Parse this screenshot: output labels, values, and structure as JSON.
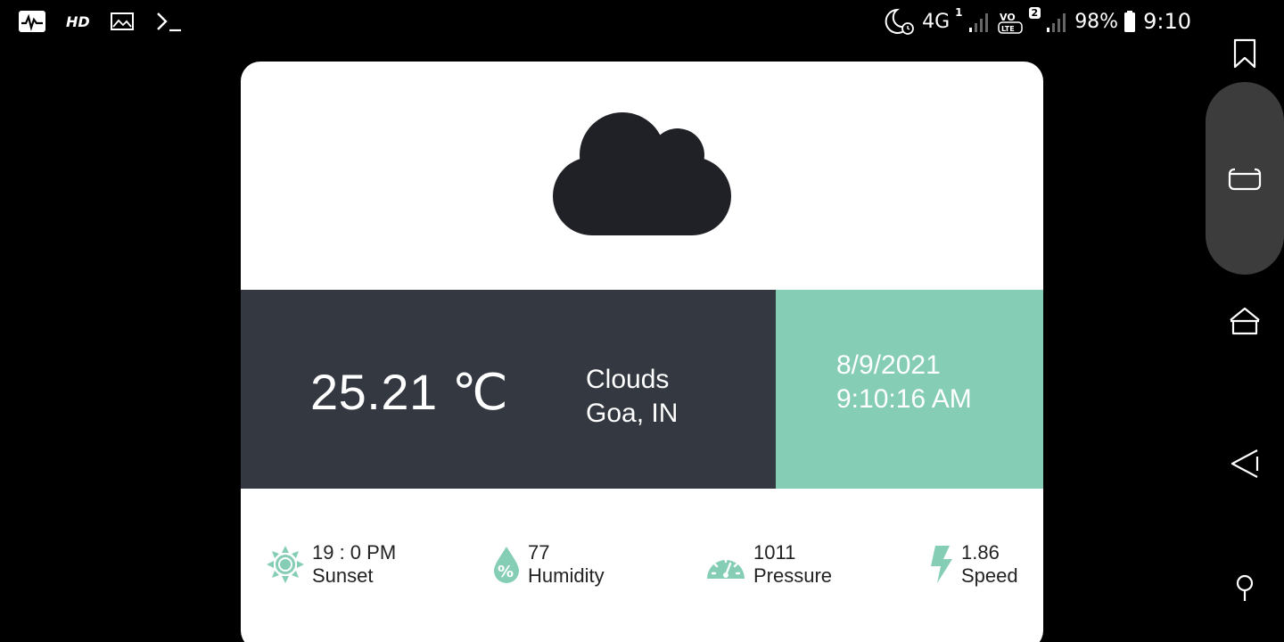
{
  "status_bar": {
    "left_icons": [
      "activity-icon",
      "hd-icon",
      "image-icon",
      "terminal-icon"
    ],
    "hd_label": "HD",
    "network": "4G",
    "sim1": "1",
    "volte": "VO LTE",
    "sim2": "2",
    "battery": "98%",
    "time": "9:10"
  },
  "weather": {
    "condition_icon": "cloud-icon",
    "temperature": "25.21 ℃",
    "condition": "Clouds",
    "location": "Goa, IN",
    "date": "8/9/2021",
    "time": "9:10:16 AM"
  },
  "stats": [
    {
      "icon": "sun-icon",
      "value": "19 : 0 PM",
      "label": "Sunset"
    },
    {
      "icon": "humidity-drop-icon",
      "value": "77",
      "label": "Humidity"
    },
    {
      "icon": "gauge-icon",
      "value": "1011",
      "label": "Pressure"
    },
    {
      "icon": "lightning-icon",
      "value": "1.86",
      "label": "Speed"
    }
  ],
  "colors": {
    "card_bg": "#ffffff",
    "main_panel": "#343841",
    "accent": "#85cdb5",
    "cloud": "#1f2127"
  },
  "nav": [
    "bookmark-icon",
    "recent-apps-icon",
    "home-icon",
    "back-icon",
    "pin-icon"
  ]
}
